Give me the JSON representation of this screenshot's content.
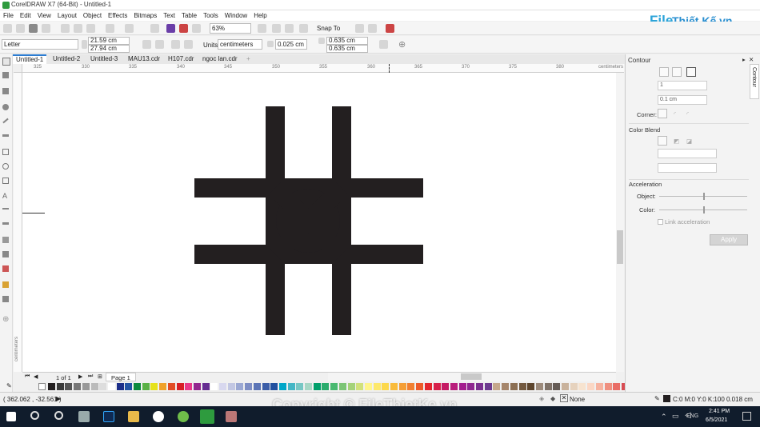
{
  "app": {
    "title": "CorelDRAW X7 (64-Bit) - Untitled-1"
  },
  "menu": [
    "File",
    "Edit",
    "View",
    "Layout",
    "Object",
    "Effects",
    "Bitmaps",
    "Text",
    "Table",
    "Tools",
    "Window",
    "Help"
  ],
  "branding": {
    "logo_a": "File",
    "logo_b": "Thiết Kế.vn"
  },
  "toolbar": {
    "zoom": "63%",
    "snap_to": "Snap To"
  },
  "property_bar": {
    "page_size": "Letter",
    "width": "21.59 cm",
    "height": "27.94 cm",
    "units_label": "Units:",
    "units": "centimeters",
    "nudge": "0.025 cm",
    "dup_x": "0.635 cm",
    "dup_y": "0.635 cm"
  },
  "tabs": [
    "Untitled-1",
    "Untitled-2",
    "Untitled-3",
    "MAU13.cdr",
    "H107.cdr",
    "ngoc lan.cdr"
  ],
  "ruler": {
    "h_labels": [
      "325",
      "330",
      "335",
      "340",
      "345",
      "350",
      "355",
      "360",
      "365",
      "370",
      "375",
      "380"
    ],
    "unit": "centimeters",
    "v_unit": "centimeters"
  },
  "page_nav": {
    "position": "1 of 1",
    "page": "Page 1"
  },
  "docker": {
    "title": "Contour",
    "steps": "1",
    "offset": "0.1 cm",
    "corner_label": "Corner:",
    "color_blend_label": "Color Blend",
    "acceleration_label": "Acceleration",
    "object_label": "Object:",
    "color_label": "Color:",
    "object_accel": 0.5,
    "color_accel": 0.5,
    "link_label": "Link acceleration",
    "apply_label": "Apply",
    "side_tab": "Contour"
  },
  "status": {
    "coords": "( 362.062 , -32.561 )",
    "fill_label": "None",
    "outline": "C:0 M:0 Y:0 K:100  0.018 cm"
  },
  "watermark": "Copyright © FileThietKe.vn",
  "system": {
    "lang": "ENG",
    "time": "2:41 PM",
    "date": "6/5/2021"
  },
  "colors": {
    "shape": "#231f20",
    "accent": "#2c7cd1",
    "taskbar": "#101c2c"
  },
  "palette": [
    "#231f20",
    "#3a3a3a",
    "#555",
    "#777",
    "#999",
    "#bbb",
    "#ddd",
    "#fff",
    "#1c2f8a",
    "#2354a4",
    "#0d8b3e",
    "#5ab146",
    "#e6e21a",
    "#f0a22a",
    "#e24d25",
    "#d71f26",
    "#e83a8a",
    "#93278f",
    "#662d91",
    "#fff",
    "#d8d8ef",
    "#c2c7e3",
    "#9ba8d3",
    "#7e8ec4",
    "#5b74b6",
    "#3c5ea8",
    "#21509f",
    "#00a6c8",
    "#44b6c5",
    "#77c7c4",
    "#a7d7c5",
    "#009f6a",
    "#2bac6d",
    "#4ab971",
    "#7cc576",
    "#a4d279",
    "#d1e17a",
    "#fff58b",
    "#fde86a",
    "#fcd84c",
    "#f9bb3b",
    "#f59e35",
    "#f17f30",
    "#ed5a2a",
    "#e3262f",
    "#d7214b",
    "#c51b64",
    "#b91e7c",
    "#a31e8e",
    "#8e2890",
    "#7a3090",
    "#6d3a8f",
    "#c6a88c",
    "#a6866b",
    "#8c6f53",
    "#73593f",
    "#5e462e",
    "#9c8a7b",
    "#7f7268",
    "#655b55",
    "#c9b29c",
    "#e6d2bd",
    "#f7e3cf",
    "#fbd7c4",
    "#f6b3a0",
    "#ef8f7f",
    "#e96d66",
    "#d84c53",
    "#c63042",
    "#f49ac1",
    "#f6b9d3",
    "#f8d5e3",
    "#e5c9e2",
    "#c8a9d3",
    "#a98cc2",
    "#8a6fb1",
    "#6b53a0",
    "#4c3890",
    "#3b2a80"
  ]
}
